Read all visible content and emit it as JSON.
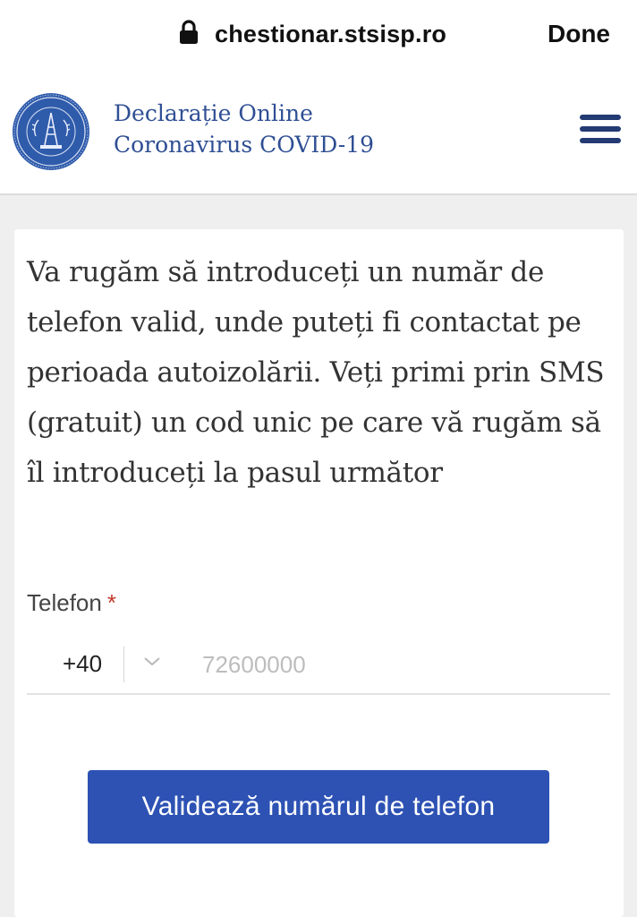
{
  "browser": {
    "url": "chestionar.stsisp.ro",
    "done_label": "Done"
  },
  "header": {
    "title_line1": "Declarație Online",
    "title_line2": "Coronavirus COVID-19",
    "logo_icon": "sts-emblem-icon",
    "menu_icon": "hamburger-menu-icon"
  },
  "form": {
    "instructions": "Va rugăm să introduceți un număr de telefon valid, unde puteți fi contactat pe perioada autoizolării. Veți primi prin SMS (gratuit) un cod unic pe care vă rugăm să îl introduceți la pasul următor",
    "phone_label": "Telefon",
    "required_mark": "*",
    "country_code": "+40",
    "phone_value": "",
    "phone_placeholder": "72600000",
    "submit_label": "Validează numărul de telefon"
  },
  "colors": {
    "brand_blue": "#2d52b4",
    "title_blue": "#2f4f94",
    "menu_navy": "#233a73",
    "required_red": "#c0392b"
  }
}
